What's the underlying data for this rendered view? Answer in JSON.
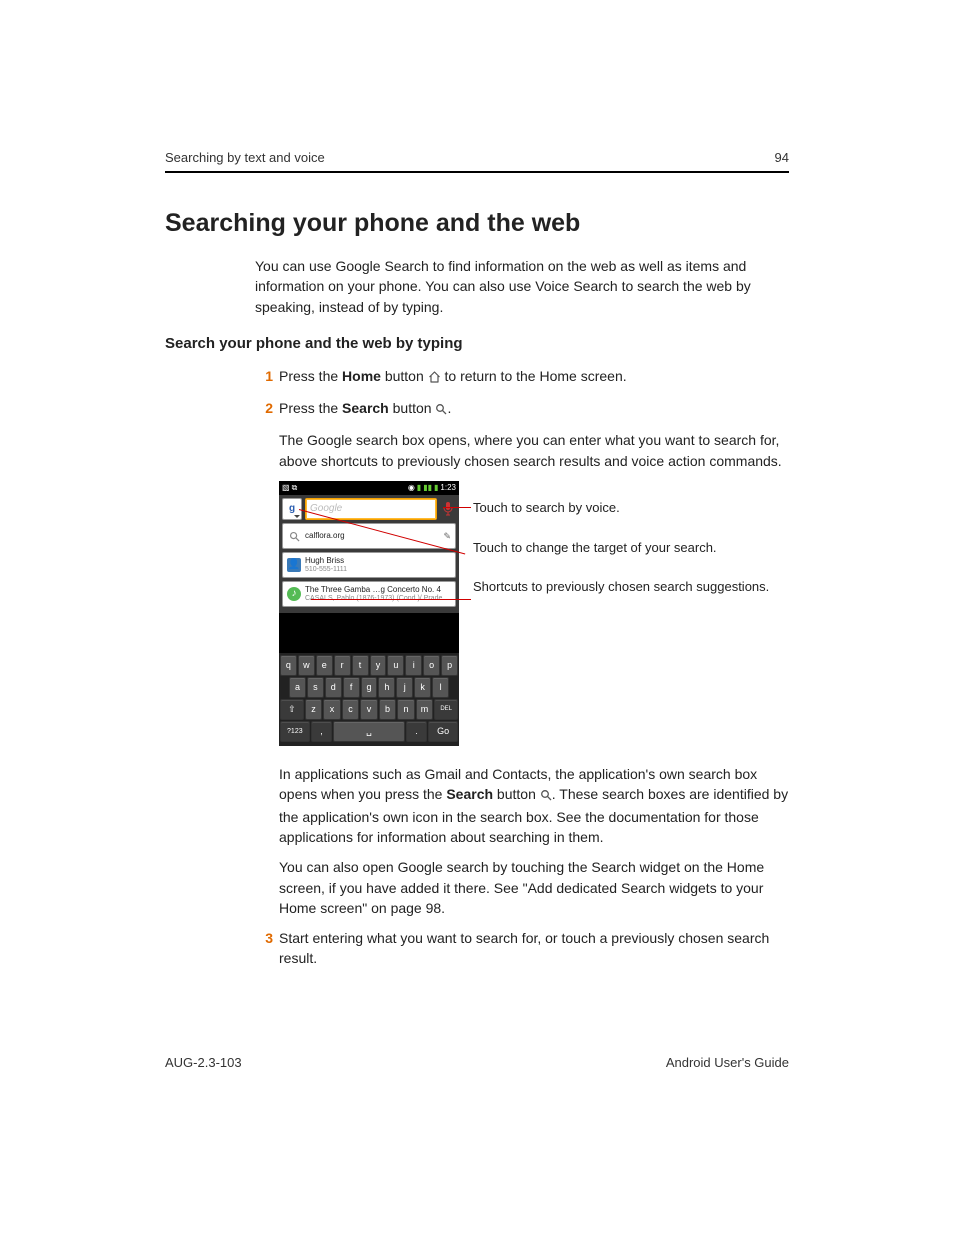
{
  "header": {
    "section": "Searching by text and voice",
    "page_number": "94"
  },
  "title": "Searching your phone and the web",
  "intro": "You can use Google Search to find information on the web as well as items and information on your phone. You can also use Voice Search to search the web by speaking, instead of by typing.",
  "section_title": "Search your phone and the web by typing",
  "steps": {
    "s1": {
      "num": "1",
      "pre": "Press the ",
      "bold": "Home",
      "post": " button ",
      "tail": " to return to the Home screen."
    },
    "s2": {
      "num": "2",
      "pre": "Press the ",
      "bold": "Search",
      "post": " button ",
      "tail": ".",
      "p2": "The Google search box opens, where you can enter what you want to search for, above shortcuts to previously chosen search results and voice action commands.",
      "p3a": "In applications such as Gmail and Contacts, the application's own search box opens when you press the ",
      "p3bold": "Search",
      "p3b": " button ",
      "p3c": ". These search boxes are identified by the application's own icon in the search box. See the documentation for those applications for information about searching in them.",
      "p4": "You can also open Google search by touching the Search widget on the Home screen, if you have added it there. See \"Add dedicated Search widgets to your Home screen\" on page 98."
    },
    "s3": {
      "num": "3",
      "text": "Start entering what you want to search for, or touch a previously chosen search result."
    }
  },
  "screenshot": {
    "status": {
      "time": "1:23"
    },
    "search_placeholder": "Google",
    "g_label": "g",
    "suggestions": [
      {
        "icon": "search",
        "line1": "calflora.org",
        "line2": ""
      },
      {
        "icon": "contact",
        "line1": "Hugh Briss",
        "line2": "510-555-1111"
      },
      {
        "icon": "music",
        "line1": "The Three Gamba …g Concerto No. 4",
        "line2": "CASALS, Pablo (1876-1973) (Cond.)/ Prade…"
      }
    ],
    "keyboard": {
      "row1": [
        "q",
        "w",
        "e",
        "r",
        "t",
        "y",
        "u",
        "i",
        "o",
        "p"
      ],
      "row2": [
        "a",
        "s",
        "d",
        "f",
        "g",
        "h",
        "j",
        "k",
        "l"
      ],
      "row3_shift": "⇧",
      "row3": [
        "z",
        "x",
        "c",
        "v",
        "b",
        "n",
        "m"
      ],
      "row3_del": "DEL",
      "row4": {
        "sym": "?123",
        "comma": ",",
        "period": ".",
        "go": "Go"
      }
    }
  },
  "callouts": {
    "c1": "Touch to search by voice.",
    "c2": "Touch to change the target of your search.",
    "c3": "Shortcuts to previously chosen search suggestions."
  },
  "footer": {
    "left": "AUG-2.3-103",
    "right": "Android User's Guide"
  }
}
